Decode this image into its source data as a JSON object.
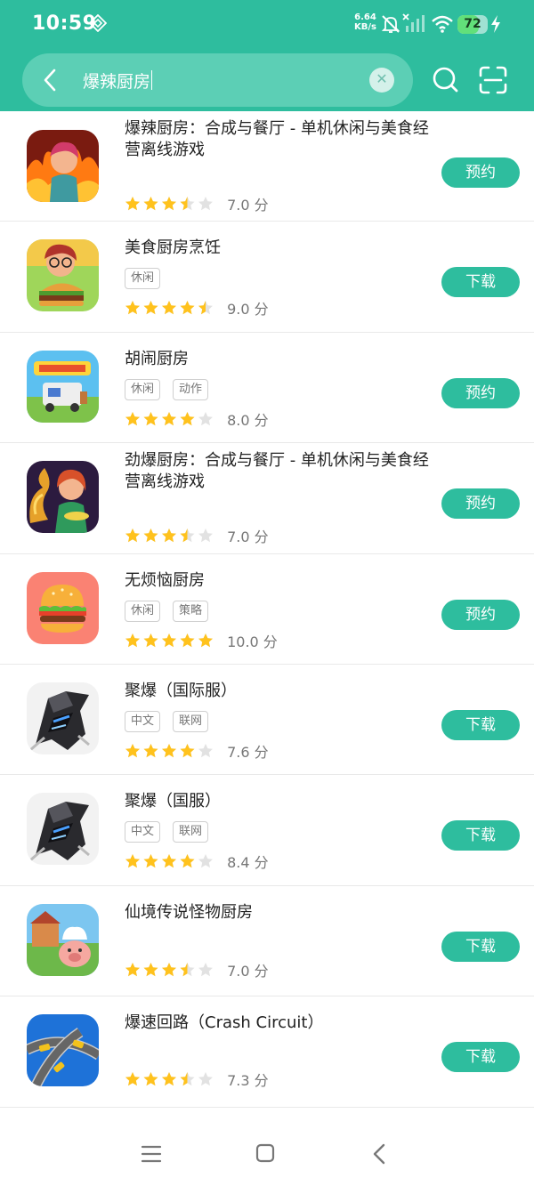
{
  "status_bar": {
    "time": "10:59",
    "net_speed": "6.64",
    "net_unit": "KB/s",
    "battery": "72",
    "battery_level": 0.72,
    "icons": [
      "nfc-icon",
      "bell-muted-icon",
      "signal-icon",
      "wifi-icon",
      "battery-icon",
      "charging-icon"
    ]
  },
  "search": {
    "query": "爆辣厨房",
    "clear_icon": "close-icon",
    "back_icon": "chevron-left-icon",
    "search_icon": "search-icon",
    "scan_icon": "scan-icon"
  },
  "colors": {
    "accent": "#2ebd9e",
    "star": "#ffc21d",
    "star_empty": "#e2e2e2"
  },
  "results": [
    {
      "name": "爆辣厨房：合成与餐厅 - 单机休闲与美食经营离线游戏",
      "tags": [],
      "rating": 3.5,
      "score": "7.0 分",
      "action": "预约",
      "icon": "chef-fire-app-icon"
    },
    {
      "name": "美食厨房烹饪",
      "tags": [
        "休闲"
      ],
      "rating": 4.5,
      "score": "9.0 分",
      "action": "下载",
      "icon": "burger-chef-app-icon"
    },
    {
      "name": "胡闹厨房",
      "tags": [
        "休闲",
        "动作"
      ],
      "rating": 4,
      "score": "8.0 分",
      "action": "预约",
      "icon": "moving-out-app-icon"
    },
    {
      "name": "劲爆厨房：合成与餐厅 - 单机休闲与美食经营离线游戏",
      "tags": [],
      "rating": 3.5,
      "score": "7.0 分",
      "action": "预约",
      "icon": "chef-dragon-app-icon"
    },
    {
      "name": "无烦恼厨房",
      "tags": [
        "休闲",
        "策略"
      ],
      "rating": 5,
      "score": "10.0 分",
      "action": "预约",
      "icon": "hamburger-app-icon"
    },
    {
      "name": "聚爆（国际服）",
      "tags": [
        "中文",
        "联网"
      ],
      "rating": 4,
      "score": "7.6 分",
      "action": "下载",
      "icon": "mecha-app-icon"
    },
    {
      "name": "聚爆（国服）",
      "tags": [
        "中文",
        "联网"
      ],
      "rating": 4,
      "score": "8.4 分",
      "action": "下载",
      "icon": "mecha-app-icon"
    },
    {
      "name": "仙境传说怪物厨房",
      "tags": [],
      "rating": 3.5,
      "score": "7.0 分",
      "action": "下载",
      "icon": "pig-chef-app-icon"
    },
    {
      "name": "爆速回路（Crash Circuit）",
      "tags": [],
      "rating": 3.5,
      "score": "7.3 分",
      "action": "下载",
      "icon": "race-cars-app-icon"
    }
  ],
  "nav_bar": {
    "icons": [
      "menu-icon",
      "home-icon",
      "back-icon"
    ]
  }
}
